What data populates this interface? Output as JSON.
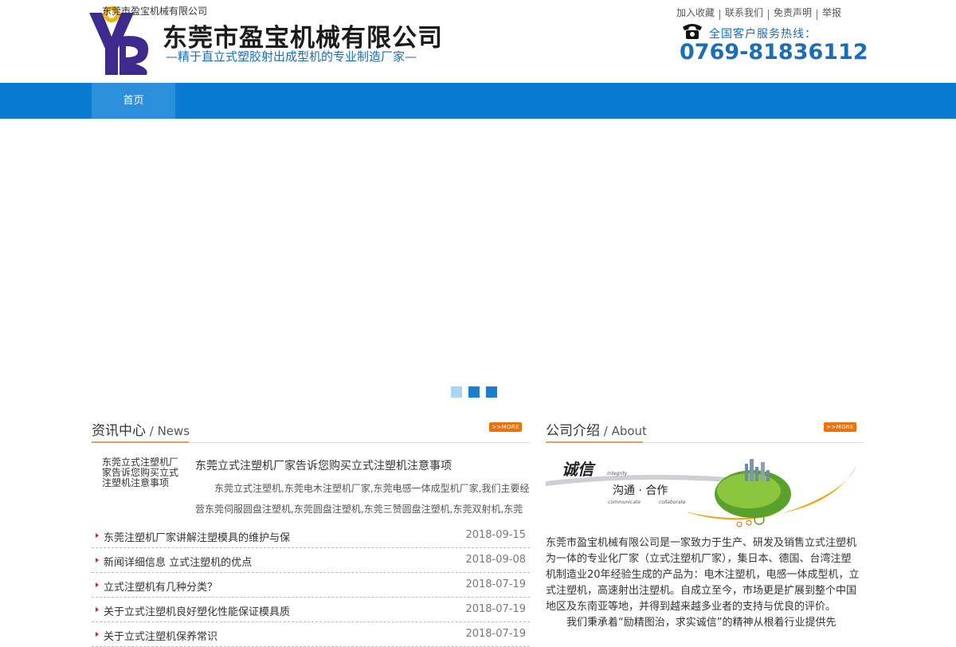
{
  "header": {
    "logo_alt": "东莞市盈宝机械有限公司",
    "company_name": "东莞市盈宝机械有限公司",
    "slogan": "—精于直立式塑胶射出成型机的专业制造厂家—",
    "top_links": [
      "加入收藏",
      "联系我们",
      "免责声明",
      "举报"
    ],
    "hotline_label": "全国客户服务热线：",
    "hotline": "0769-81836112"
  },
  "nav": {
    "items": [
      "首页"
    ]
  },
  "banner": {
    "dots": 3,
    "active_dot": 0
  },
  "news": {
    "title": "资讯中心",
    "title_en": " / News",
    "more": ">>MORE",
    "featured": {
      "thumb_text": "东莞立式注塑机厂家告诉您购买立式注塑机注意事项",
      "title": "东莞立式注塑机厂家告诉您购买立式注塑机注意事项",
      "desc": "东莞立式注塑机,东莞电木注塑机厂家,东莞电感一体成型机厂家,我们主要经营东莞伺服圆盘注塑机,东莞圆盘注塑机,东莞三赞圆盘注塑机,东莞双射机,东莞立"
    },
    "items": [
      {
        "title": "东莞注塑机厂家讲解注塑模具的维护与保",
        "date": "2018-09-15"
      },
      {
        "title": "新闻详细信息 立式注塑机的优点",
        "date": "2018-09-08"
      },
      {
        "title": "立式注塑机有几种分类？",
        "date": "2018-07-19"
      },
      {
        "title": "关于立式注塑机良好塑化性能保证模具质",
        "date": "2018-07-19"
      },
      {
        "title": "关于立式注塑机保养常识",
        "date": "2018-07-19"
      }
    ]
  },
  "about": {
    "title": "公司介绍",
    "title_en": " / About",
    "more": ">>MORE",
    "img_text_main": "诚信",
    "img_text_sub": "沟通 · 合作",
    "img_text_en1": "integrity",
    "img_text_en2": "communicate",
    "img_text_en3": "collaborate",
    "paragraph": "东莞市盈宝机械有限公司是一家致力于生产、研发及销售立式注塑机为一体的专业化厂家（立式注塑机厂家），集日本、德国、台湾注塑机制造业20年经验生成的产品为：电木注塑机，电感一体成型机，立式注塑机，高速射出注塑机。自成立至今，市场更是扩展到整个中国地区及东南亚等地，并得到越来越多业者的支持与优良的评价。",
    "paragraph2": "我们秉承着“励精图治，求实诚信”的精神从根着行业提供先"
  },
  "colors": {
    "brand_blue": "#0b7bd0",
    "accent_orange": "#e8720c",
    "text_blue": "#1a6db8"
  }
}
